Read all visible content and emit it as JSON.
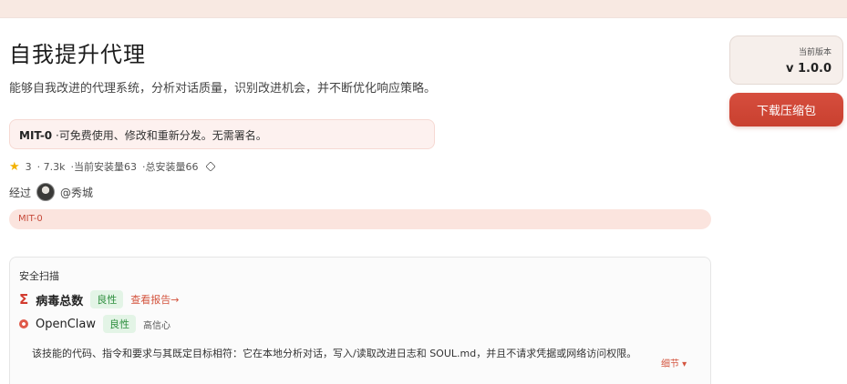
{
  "page": {
    "title": "自我提升代理",
    "description": "能够自我改进的代理系统，分析对话质量，识别改进机会，并不断优化响应策略。"
  },
  "license": {
    "code": "MIT-0",
    "text": " ·可免费使用、修改和重新分发。无需署名。"
  },
  "stats": {
    "stars": "3",
    "downloads": "· 7.3k",
    "current_installs": "·当前安装量63",
    "total_installs": "·总安装量66"
  },
  "author": {
    "prefix": "经过",
    "handle": "@秀城"
  },
  "tag": "MIT-0",
  "security": {
    "title": "安全扫描",
    "virustotal": {
      "name": "病毒总数",
      "status": "良性",
      "link": "查看报告→"
    },
    "openclaw": {
      "name": "OpenClaw",
      "status": "良性",
      "confidence": "高信心"
    },
    "summary": "该技能的代码、指令和要求与其既定目标相符：它在本地分析对话，写入/读取改进日志和 SOUL.md，并且不请求凭据或网络访问权限。",
    "details_label": "细节 ▾"
  },
  "sidebar": {
    "version_label": "当前版本",
    "version": "v 1.0.0",
    "download_label": "下载压缩包"
  },
  "colors": {
    "accent": "#d04a3a",
    "benign_bg": "#e3f4e6",
    "benign_text": "#2f8f3f"
  }
}
